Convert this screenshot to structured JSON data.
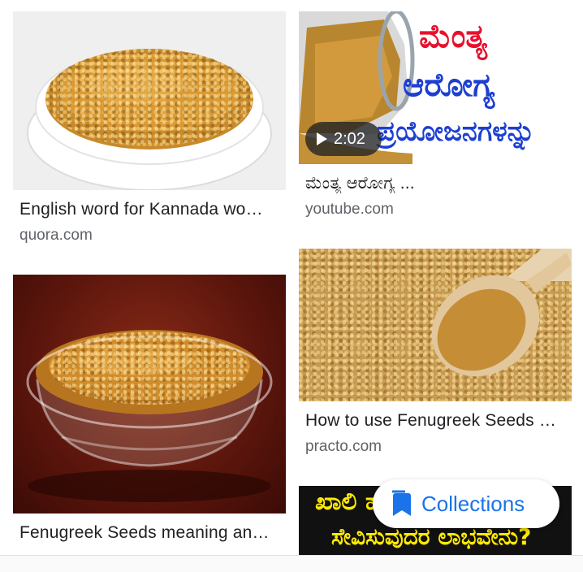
{
  "results": [
    {
      "title": "English word for Kannada wo…",
      "source": "quora.com"
    },
    {
      "title": "ಮೆಂತ್ಯ ಆರೋಗ್ಯ ...",
      "source": "youtube.com",
      "duration": "2:02",
      "overlay_text": [
        "ಮೆಂತ್ಯ",
        "ಆರೋಗ್ಯ",
        "ಪ್ರಯೋಜನಗಳನ್ನು"
      ]
    },
    {
      "title": "Fenugreek Seeds meaning an…",
      "source": ""
    },
    {
      "title": "How to use Fenugreek Seeds …",
      "source": "practo.com"
    },
    {
      "title": "",
      "source": "",
      "overlay_text": [
        "ಖಾಲಿ ಹ",
        "ಸೇವಿಸುವುದರ ಲಾಭವೇನು?"
      ]
    }
  ],
  "collections_button": {
    "label": "Collections",
    "icon": "bookmark-icon"
  },
  "colors": {
    "accent": "#1a73e8",
    "title": "#202124",
    "source": "#5f6368",
    "kannada_red": "#e8112d",
    "kannada_blue": "#1d3fd1"
  }
}
